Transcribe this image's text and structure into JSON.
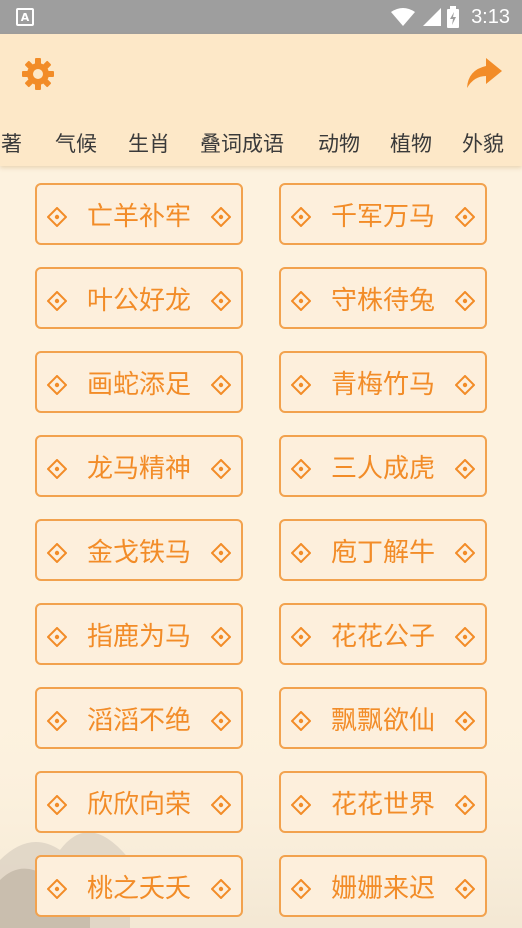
{
  "status_bar": {
    "app_badge": "A",
    "time": "3:13"
  },
  "header": {
    "settings_icon": "gear-icon",
    "share_icon": "share-icon",
    "accent_color": "#f28c28"
  },
  "tabs": [
    "名著",
    "气候",
    "生肖",
    "叠词成语",
    "动物",
    "植物",
    "外貌"
  ],
  "idioms": [
    "亡羊补牢",
    "千军万马",
    "叶公好龙",
    "守株待兔",
    "画蛇添足",
    "青梅竹马",
    "龙马精神",
    "三人成虎",
    "金戈铁马",
    "庖丁解牛",
    "指鹿为马",
    "花花公子",
    "滔滔不绝",
    "飘飘欲仙",
    "欣欣向荣",
    "花花世界",
    "桃之夭夭",
    "姗姗来迟"
  ]
}
